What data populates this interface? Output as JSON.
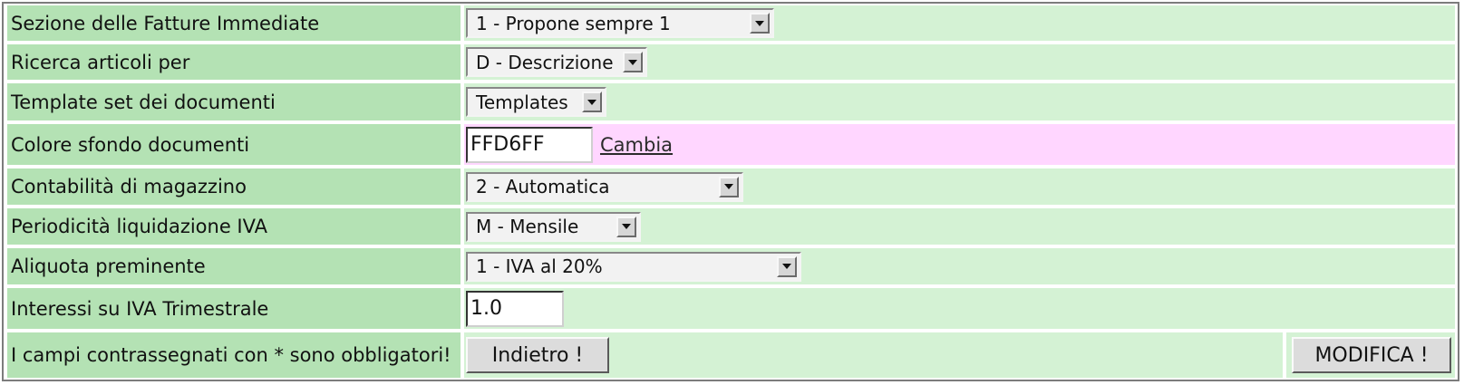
{
  "rows": [
    {
      "label": "Sezione delle Fatture Immediate",
      "value": "1 - Propone sempre 1"
    },
    {
      "label": "Ricerca articoli per",
      "value": "D - Descrizione"
    },
    {
      "label": "Template set dei documenti",
      "value": "Templates"
    },
    {
      "label": "Colore sfondo documenti",
      "value": "FFD6FF",
      "link": "Cambia"
    },
    {
      "label": "Contabilità di magazzino",
      "value": "2 - Automatica"
    },
    {
      "label": "Periodicità liquidazione IVA",
      "value": "M - Mensile"
    },
    {
      "label": "Aliquota preminente",
      "value": "1 - IVA al 20%"
    },
    {
      "label": "Interessi su IVA Trimestrale",
      "value": "1.0"
    }
  ],
  "footer": {
    "note": "I campi contrassegnati con * sono obbligatori!",
    "back_label": "Indietro !",
    "submit_label": "MODIFICA !"
  },
  "colors": {
    "label_bg": "#b4e2b4",
    "value_bg": "#d4f2d4",
    "doc_color_bg": "#ffd6ff"
  },
  "icons": {
    "select_arrow": "triangle-down-icon"
  }
}
